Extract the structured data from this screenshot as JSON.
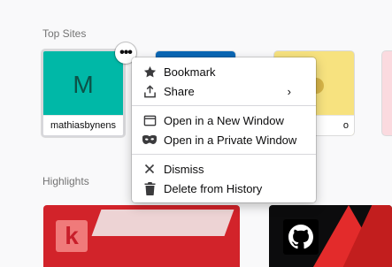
{
  "sections": {
    "top_sites_title": "Top Sites",
    "highlights_title": "Highlights"
  },
  "top_sites": [
    {
      "letter": "M",
      "label": "mathiasbynens",
      "color": "#00b8a7"
    },
    {
      "label": "",
      "color": "#0a67b5"
    },
    {
      "label": "o",
      "color": "#f7e27f"
    },
    {
      "label": "",
      "color": "#fbdadf"
    }
  ],
  "tile_menu_button": {
    "label": "•••"
  },
  "context_menu": {
    "groups": [
      [
        {
          "label": "Bookmark",
          "icon": "star-icon"
        },
        {
          "label": "Share",
          "icon": "share-icon",
          "submenu_indicator": "›"
        }
      ],
      [
        {
          "label": "Open in a New Window",
          "icon": "new-window-icon"
        },
        {
          "label": "Open in a Private Window",
          "icon": "private-mask-icon"
        }
      ],
      [
        {
          "label": "Dismiss",
          "icon": "close-icon"
        },
        {
          "label": "Delete from History",
          "icon": "trash-icon"
        }
      ]
    ]
  },
  "highlights": [
    {
      "logo_text": "k",
      "color": "#d2232a"
    },
    {
      "icon": "github-icon",
      "color": "#0c0c0d"
    }
  ]
}
